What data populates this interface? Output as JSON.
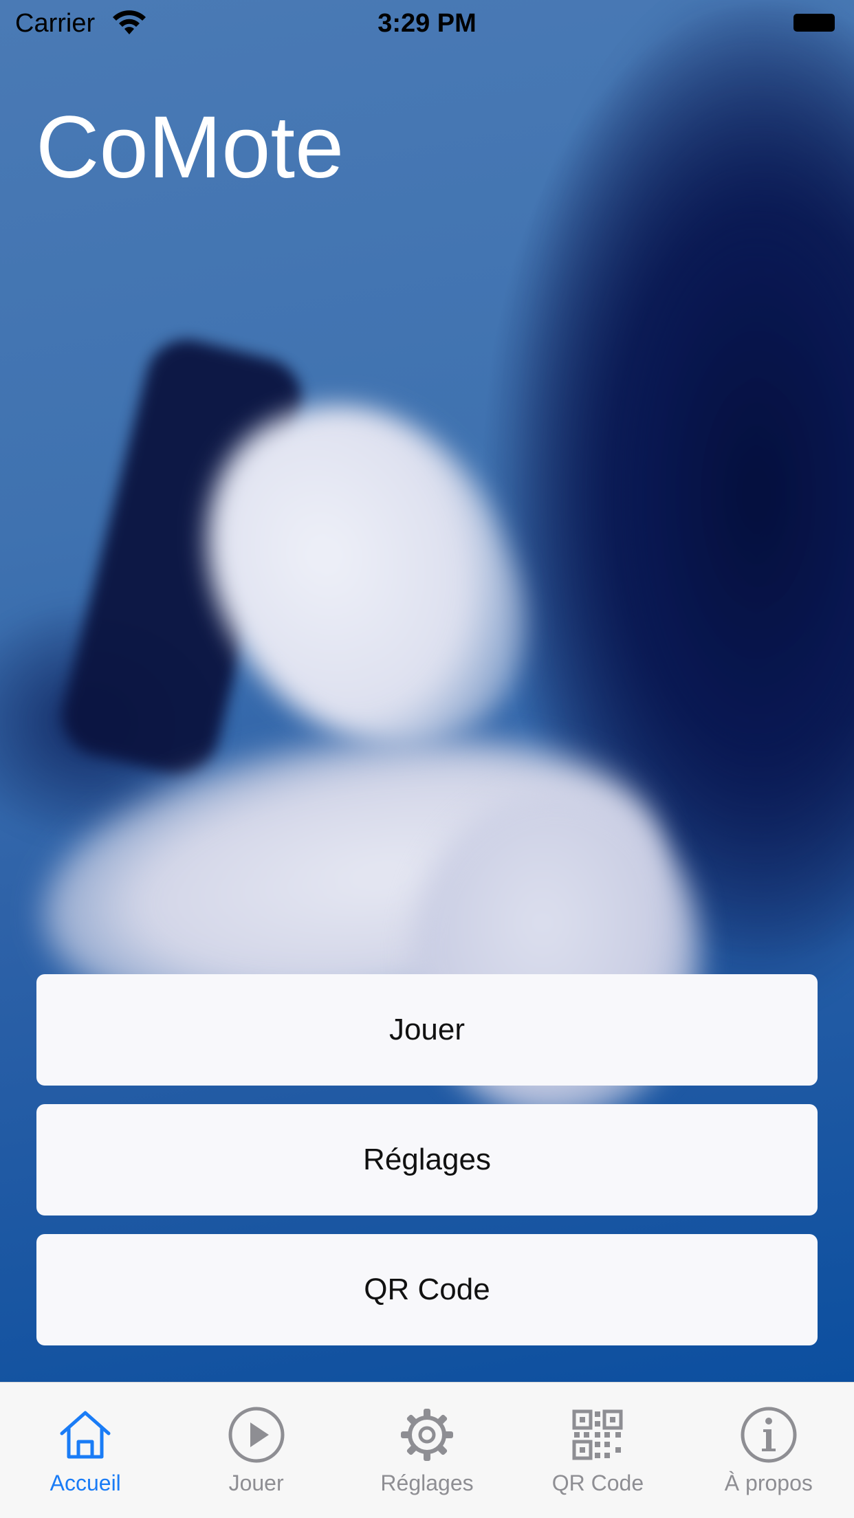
{
  "status_bar": {
    "carrier": "Carrier",
    "time": "3:29 PM",
    "icons": [
      "wifi-icon",
      "battery-icon"
    ]
  },
  "app": {
    "title": "CoMote"
  },
  "buttons": {
    "play": "Jouer",
    "settings": "Réglages",
    "qr": "QR Code"
  },
  "tab_bar": {
    "active_color": "#1a7cf6",
    "inactive_color": "#8e8e93",
    "items": [
      {
        "label": "Accueil",
        "icon": "house-icon",
        "active": true
      },
      {
        "label": "Jouer",
        "icon": "play-circle-icon",
        "active": false
      },
      {
        "label": "Réglages",
        "icon": "gear-icon",
        "active": false
      },
      {
        "label": "QR Code",
        "icon": "qr-code-icon",
        "active": false
      },
      {
        "label": "À propos",
        "icon": "info-icon",
        "active": false
      }
    ]
  }
}
